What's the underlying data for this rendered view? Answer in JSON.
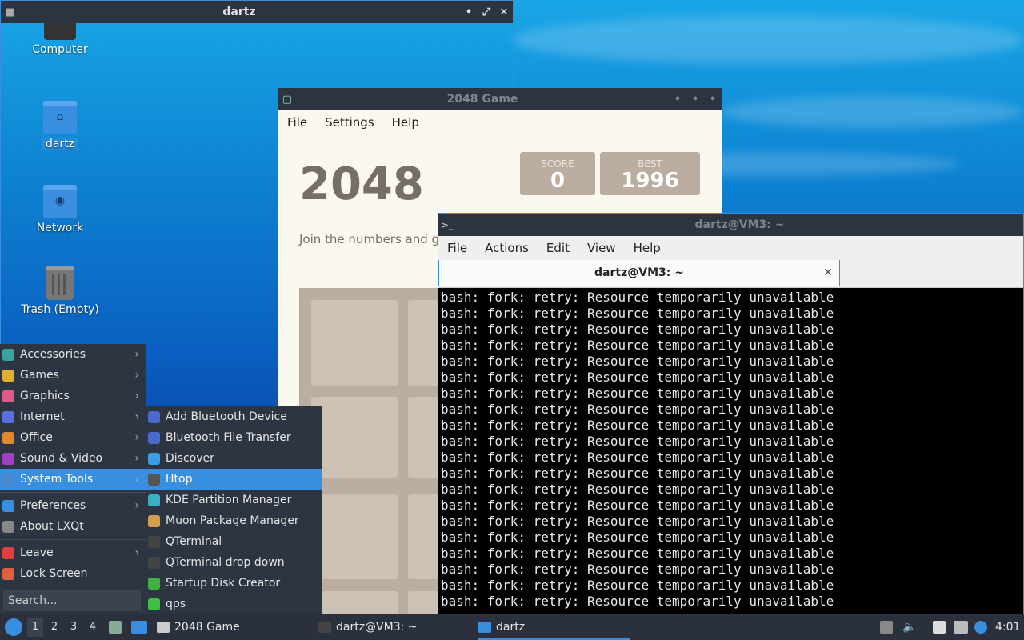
{
  "desktop": {
    "icons": [
      {
        "label": "Computer"
      },
      {
        "label": "dartz"
      },
      {
        "label": "Network"
      },
      {
        "label": "Trash (Empty)"
      }
    ]
  },
  "file_manager": {
    "title": "dartz",
    "controls": {
      "minimize": "•",
      "maximize": "⤢",
      "close": "✕"
    }
  },
  "game": {
    "title": "2048 Game",
    "menu": [
      "File",
      "Settings",
      "Help"
    ],
    "heading": "2048",
    "score": {
      "label": "SCORE",
      "value": "0"
    },
    "best": {
      "label": "BEST",
      "value": "1996"
    },
    "intro": "Join the numbers and ge"
  },
  "terminal": {
    "title": "dartz@VM3: ~",
    "menu": [
      "File",
      "Actions",
      "Edit",
      "View",
      "Help"
    ],
    "tab_label": "dartz@VM3: ~",
    "line": "bash: fork: retry: Resource temporarily unavailable",
    "line_count": 20
  },
  "start_menu": {
    "items": [
      {
        "label": "Accessories",
        "icon": "accessories-icon",
        "color": "#3aa3a0",
        "submenu": true
      },
      {
        "label": "Games",
        "icon": "games-icon",
        "color": "#e0b030",
        "submenu": true
      },
      {
        "label": "Graphics",
        "icon": "graphics-icon",
        "color": "#e05a8a",
        "submenu": true
      },
      {
        "label": "Internet",
        "icon": "internet-icon",
        "color": "#5a6ee0",
        "submenu": true
      },
      {
        "label": "Office",
        "icon": "office-icon",
        "color": "#e08a30",
        "submenu": true
      },
      {
        "label": "Sound & Video",
        "icon": "sound-video-icon",
        "color": "#a040c0",
        "submenu": true
      },
      {
        "label": "System Tools",
        "icon": "system-tools-icon",
        "color": "#4a8ad0",
        "submenu": true,
        "selected": true
      }
    ],
    "items2": [
      {
        "label": "Preferences",
        "icon": "preferences-icon",
        "color": "#3a8ee0",
        "submenu": true
      },
      {
        "label": "About LXQt",
        "icon": "info-icon",
        "color": "#888888",
        "submenu": false
      }
    ],
    "items3": [
      {
        "label": "Leave",
        "icon": "power-icon",
        "color": "#e04040",
        "submenu": true
      },
      {
        "label": "Lock Screen",
        "icon": "lock-icon",
        "color": "#e06040",
        "submenu": false
      }
    ],
    "search_placeholder": "Search..."
  },
  "system_tools": {
    "items": [
      {
        "label": "Add Bluetooth Device",
        "icon": "bluetooth-icon",
        "color": "#4a6ad0"
      },
      {
        "label": "Bluetooth File Transfer",
        "icon": "bluetooth-icon",
        "color": "#4a6ad0"
      },
      {
        "label": "Discover",
        "icon": "discover-icon",
        "color": "#3a9ee0"
      },
      {
        "label": "Htop",
        "icon": "htop-icon",
        "color": "#555555",
        "selected": true
      },
      {
        "label": "KDE Partition Manager",
        "icon": "partition-icon",
        "color": "#3ab0c0"
      },
      {
        "label": "Muon Package Manager",
        "icon": "package-icon",
        "color": "#d0a050"
      },
      {
        "label": "QTerminal",
        "icon": "terminal-icon",
        "color": "#444444"
      },
      {
        "label": "QTerminal drop down",
        "icon": "terminal-icon",
        "color": "#444444"
      },
      {
        "label": "Startup Disk Creator",
        "icon": "disk-creator-icon",
        "color": "#40b040"
      },
      {
        "label": "qps",
        "icon": "qps-icon",
        "color": "#40c040"
      }
    ]
  },
  "taskbar": {
    "workspaces": [
      "1",
      "2",
      "3",
      "4"
    ],
    "tasks": [
      {
        "label": "2048 Game"
      },
      {
        "label": "dartz@VM3: ~"
      },
      {
        "label": "dartz"
      }
    ],
    "clock": "4:01"
  }
}
